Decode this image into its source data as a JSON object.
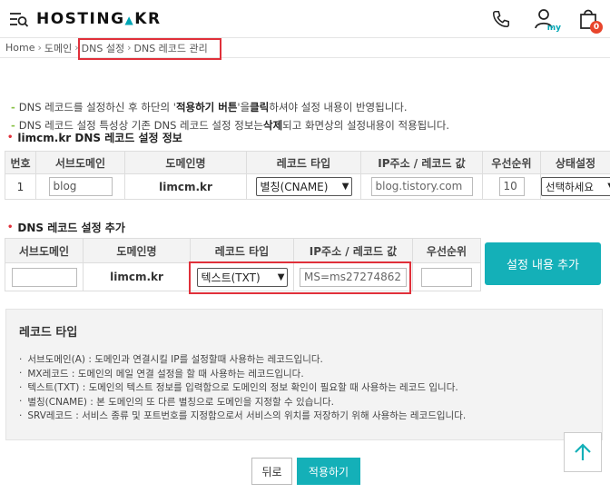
{
  "header": {
    "logo": "HOSTING",
    "logo_dot": "▲",
    "logo_suffix": "KR",
    "my_label": "my",
    "cart_count": "0"
  },
  "breadcrumb": [
    "Home",
    "도메인",
    "DNS 설정",
    "DNS 레코드 관리"
  ],
  "notices": [
    {
      "pre": "DNS 레코드를 설정하신 후 하단의 '",
      "bold": "적용하기 버튼",
      "mid": "'을 ",
      "bold2": "클릭",
      "post": "하셔야 설정 내용이 반영됩니다."
    },
    {
      "pre": "DNS 레코드 설정 특성상 기존 DNS 레코드 설정 정보는 ",
      "bold": "삭제",
      "mid": "되고 화면상의 설정내용이 적용됩니다.",
      "bold2": "",
      "post": ""
    }
  ],
  "section1_title": "limcm.kr DNS 레코드 설정 정보",
  "table1": {
    "headers": [
      "번호",
      "서브도메인",
      "도메인명",
      "레코드 타입",
      "IP주소 / 레코드 값",
      "우선순위",
      "상태설정"
    ],
    "row": {
      "num": "1",
      "subdomain": "blog",
      "domain": "limcm.kr",
      "record_type": "별칭(CNAME)",
      "value": "blog.tistory.com",
      "priority": "10",
      "status": "선택하세요"
    }
  },
  "section2_title": "DNS 레코드 설정 추가",
  "table2": {
    "headers": [
      "서브도메인",
      "도메인명",
      "레코드 타입",
      "IP주소 / 레코드 값",
      "우선순위"
    ],
    "row": {
      "subdomain": "",
      "domain": "limcm.kr",
      "record_type": "텍스트(TXT)",
      "value": "MS=ms27274862",
      "priority": ""
    },
    "add_button": "설정 내용 추가"
  },
  "record_types": {
    "title": "레코드 타입",
    "lines": [
      "서브도메인(A) : 도메인과 연결시킬 IP를 설정할때 사용하는 레코드입니다.",
      "MX레코드 : 도메인의 메일 연결 설정을 할 때 사용하는 레코드입니다.",
      "텍스트(TXT) : 도메인의 텍스트 정보를 입력함으로 도메인의 정보 확인이 필요할 때 사용하는 레코드 입니다.",
      "별칭(CNAME) : 본 도메인의 또 다른 별칭으로 도메인을 지정할 수 있습니다.",
      "SRV레코드 : 서비스 종류 및 포트번호를 지정함으로서 서비스의 위치를 저장하기 위해 사용하는 레코드입니다."
    ]
  },
  "buttons": {
    "back": "뒤로",
    "apply": "적용하기"
  },
  "colors": {
    "accent": "#14b0b8",
    "highlight": "#e0303a",
    "dash": "#8bc34a"
  }
}
